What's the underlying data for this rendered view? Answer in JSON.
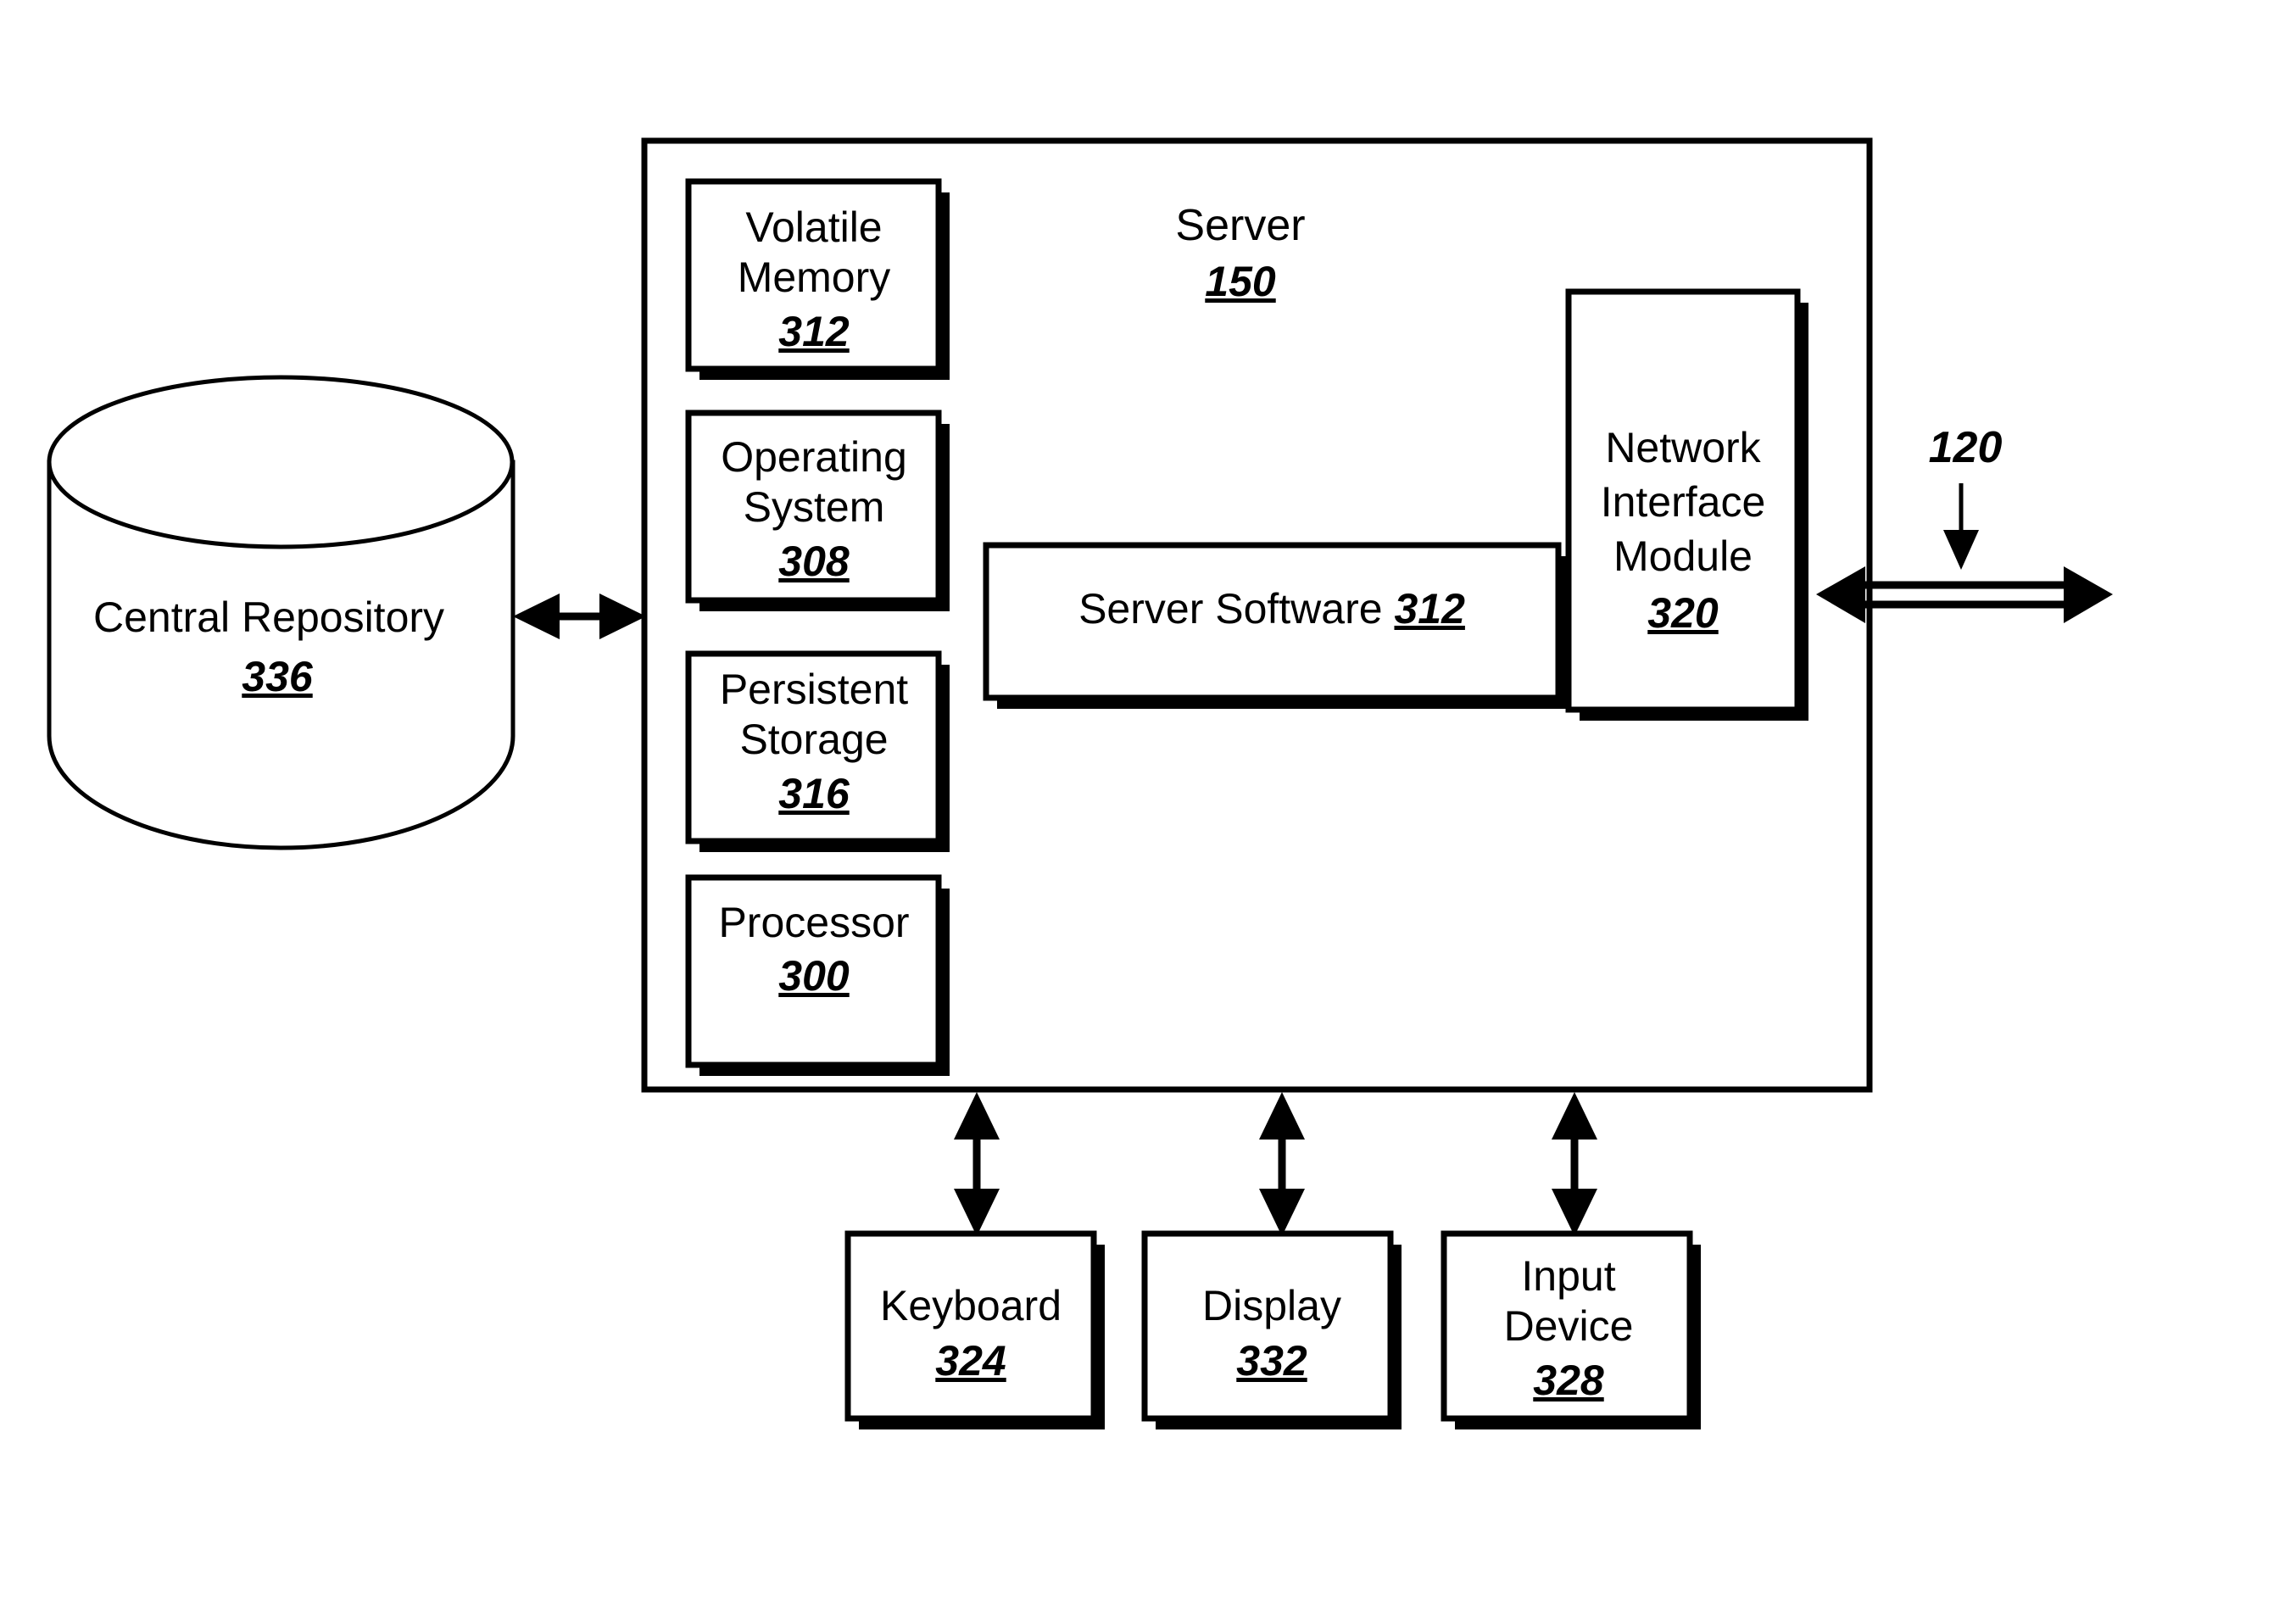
{
  "figure": {
    "type": "patent-block-diagram",
    "background_color": "#ffffff",
    "line_color": "#000000"
  },
  "server": {
    "title": "Server",
    "ref": "150"
  },
  "repository": {
    "label": "Central Repository",
    "ref": "336"
  },
  "network": {
    "ref": "120"
  },
  "modules": [
    {
      "name": "volatile-memory",
      "line1": "Volatile",
      "line2": "Memory",
      "ref": "312"
    },
    {
      "name": "operating-system",
      "line1": "Operating",
      "line2": "System",
      "ref": "308"
    },
    {
      "name": "persistent-storage",
      "line1": "Persistent",
      "line2": "Storage",
      "ref": "316"
    },
    {
      "name": "processor",
      "line1": "Processor",
      "line2": "",
      "ref": "300"
    }
  ],
  "server_software": {
    "label": "Server Software",
    "ref": "312"
  },
  "network_interface_module": {
    "line1": "Network",
    "line2": "Interface",
    "line3": "Module",
    "ref": "320"
  },
  "peripherals": [
    {
      "name": "keyboard",
      "line1": "Keyboard",
      "line2": "",
      "ref": "324"
    },
    {
      "name": "display",
      "line1": "Display",
      "line2": "",
      "ref": "332"
    },
    {
      "name": "input-device",
      "line1": "Input",
      "line2": "Device",
      "ref": "328"
    }
  ]
}
